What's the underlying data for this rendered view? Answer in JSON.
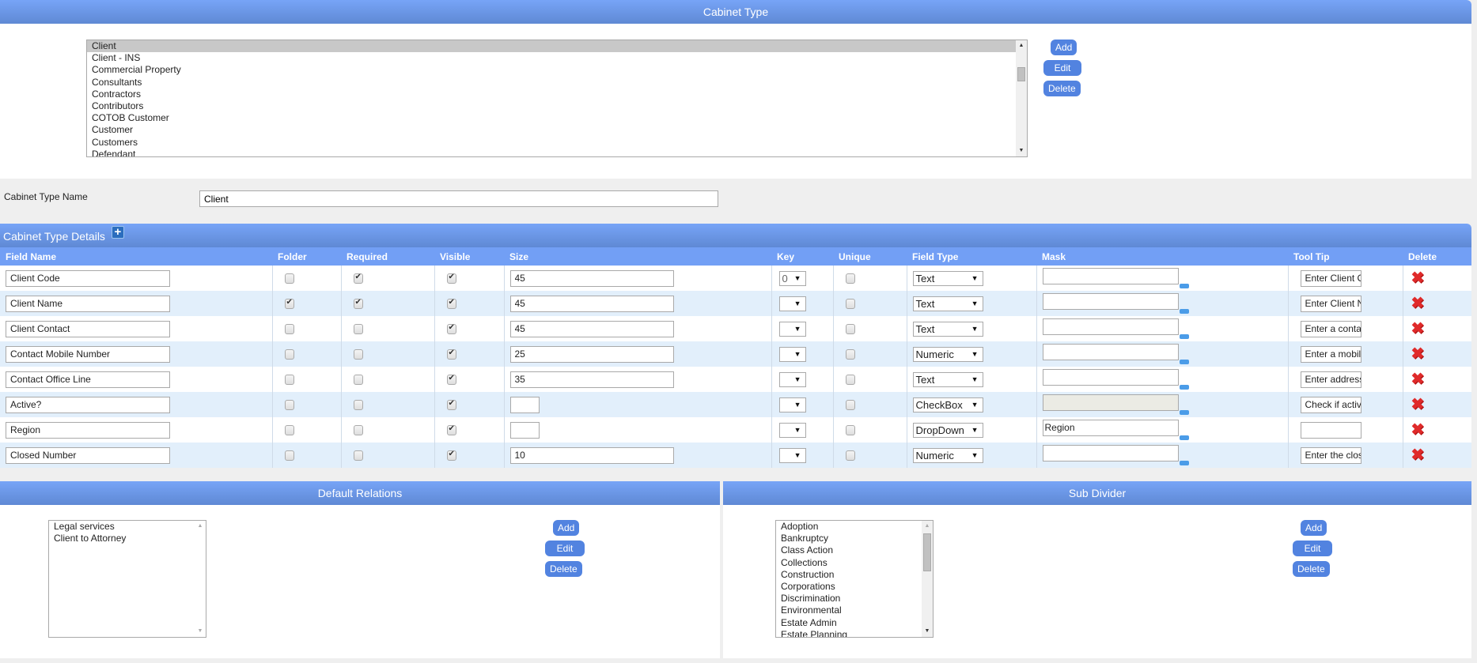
{
  "cabinet_type": {
    "title": "Cabinet Type",
    "items": [
      "Client",
      "Client - INS",
      "Commercial Property",
      "Consultants",
      "Contractors",
      "Contributors",
      "COTOB Customer",
      "Customer",
      "Customers",
      "Defendant"
    ],
    "selected": "Client",
    "buttons": {
      "add": "Add",
      "edit": "Edit",
      "delete": "Delete"
    }
  },
  "name_field": {
    "label": "Cabinet Type Name",
    "value": "Client"
  },
  "details": {
    "title": "Cabinet Type Details",
    "add_icon": "plus-icon",
    "columns": [
      "Field Name",
      "Folder",
      "Required",
      "Visible",
      "Size",
      "Key",
      "Unique",
      "Field Type",
      "Mask",
      "Tool Tip",
      "Delete"
    ],
    "rows": [
      {
        "field_name": "Client Code",
        "folder": false,
        "required": true,
        "visible": true,
        "size": "45",
        "key": "0",
        "unique": false,
        "field_type": "Text",
        "mask": "",
        "mask_disabled": false,
        "tooltip": "Enter Client Code"
      },
      {
        "field_name": "Client Name",
        "folder": true,
        "required": true,
        "visible": true,
        "size": "45",
        "key": "",
        "unique": false,
        "field_type": "Text",
        "mask": "",
        "mask_disabled": false,
        "tooltip": "Enter Client Name"
      },
      {
        "field_name": "Client Contact",
        "folder": false,
        "required": false,
        "visible": true,
        "size": "45",
        "key": "",
        "unique": false,
        "field_type": "Text",
        "mask": "",
        "mask_disabled": false,
        "tooltip": "Enter a contact"
      },
      {
        "field_name": "Contact Mobile Number",
        "folder": false,
        "required": false,
        "visible": true,
        "size": "25",
        "key": "",
        "unique": false,
        "field_type": "Numeric",
        "mask": "",
        "mask_disabled": false,
        "tooltip": "Enter a mobile"
      },
      {
        "field_name": "Contact Office Line",
        "folder": false,
        "required": false,
        "visible": true,
        "size": "35",
        "key": "",
        "unique": false,
        "field_type": "Text",
        "mask": "",
        "mask_disabled": false,
        "tooltip": "Enter address"
      },
      {
        "field_name": "Active?",
        "folder": false,
        "required": false,
        "visible": true,
        "size": "",
        "key": "",
        "unique": false,
        "field_type": "CheckBox",
        "mask": "",
        "mask_disabled": true,
        "tooltip": "Check if active"
      },
      {
        "field_name": "Region",
        "folder": false,
        "required": false,
        "visible": true,
        "size": "",
        "key": "",
        "unique": false,
        "field_type": "DropDown",
        "mask": "Region",
        "mask_disabled": false,
        "tooltip": ""
      },
      {
        "field_name": "Closed Number",
        "folder": false,
        "required": false,
        "visible": true,
        "size": "10",
        "key": "",
        "unique": false,
        "field_type": "Numeric",
        "mask": "",
        "mask_disabled": false,
        "tooltip": "Enter the closed"
      }
    ]
  },
  "default_relations": {
    "title": "Default Relations",
    "items": [
      "Legal services",
      "Client to Attorney"
    ],
    "buttons": {
      "add": "Add",
      "edit": "Edit",
      "delete": "Delete"
    }
  },
  "sub_divider": {
    "title": "Sub Divider",
    "items": [
      "Adoption",
      "Bankruptcy",
      "Class Action",
      "Collections",
      "Construction",
      "Corporations",
      "Discrimination",
      "Environmental",
      "Estate Admin",
      "Estate Planning"
    ],
    "buttons": {
      "add": "Add",
      "edit": "Edit",
      "delete": "Delete"
    }
  },
  "colors": {
    "header_gradient_top": "#77a4f7",
    "header_gradient_bottom": "#5f89d4",
    "button": "#5283e0",
    "row_alt": "#e2effb",
    "delete_icon": "#e02a2a"
  }
}
